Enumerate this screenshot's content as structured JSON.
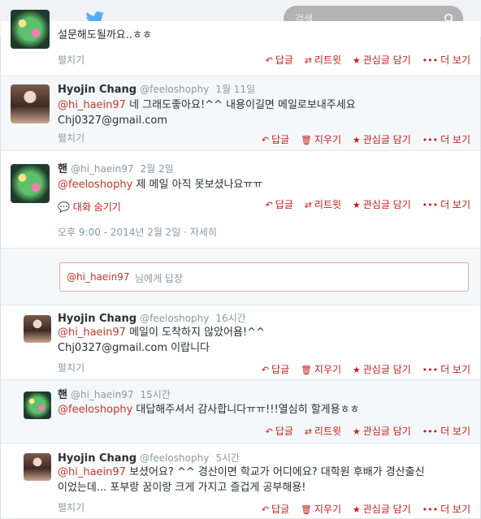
{
  "search": {
    "placeholder": "검색"
  },
  "colors": {
    "accent": "#c41e1e",
    "mention": "#c0392b",
    "twitter_blue": "#55acee"
  },
  "actions": {
    "reply": "답글",
    "retweet": "리트윗",
    "delete": "지우기",
    "favorite": "관심글 담기",
    "more": "더 보기"
  },
  "expand_label": "펼치기",
  "tweets": [
    {
      "text_line1": "설문해도될까요..ㅎㅎ"
    },
    {
      "name": "Hyojin Chang",
      "handle": "@feeloshophy",
      "time": "1월 11일",
      "mention": "@hi_haein97",
      "text_line1": " 네 그래도좋아요!^^ 내용이길면 메일로보내주세요",
      "text_line2": "Chj0327@gmail.com"
    },
    {
      "name": "핸",
      "handle": "@hi_haein97",
      "time": "2월 2일",
      "mention": "@feeloshophy",
      "text_line1": " 제 메일 아직 못보셨나요ㅠㅠ",
      "hide_conversation": "대화 숨기기",
      "timestamp_detail": "오후 9:00 - 2014년 2월 2일",
      "detail_link": "자세히"
    },
    {
      "name": "Hyojin Chang",
      "handle": "@feeloshophy",
      "time": "16시간",
      "mention": "@hi_haein97",
      "text_line1": " 메일이 도착하지 않았어욤!^^",
      "text_line2": "Chj0327@gmail.com 이랍니다"
    },
    {
      "name": "핸",
      "handle": "@hi_haein97",
      "time": "15시간",
      "mention": "@feeloshophy",
      "text_line1": " 대답해주셔서 감사합니다ㅠㅠ!!!열심히 할게용ㅎㅎ"
    },
    {
      "name": "Hyojin Chang",
      "handle": "@feeloshophy",
      "time": "5시간",
      "mention": "@hi_haein97",
      "text_line1": " 보셨어요? ^^ 경산이면 학교가 어디에요? 대학원 후배가 경산출신",
      "text_line2": "이었는데... 포부랑 꿈이랑 크게 가지고 즐겁게 공부해용!"
    }
  ],
  "reply_box": {
    "mention": "@hi_haein97",
    "rest": "님에게 답장"
  }
}
